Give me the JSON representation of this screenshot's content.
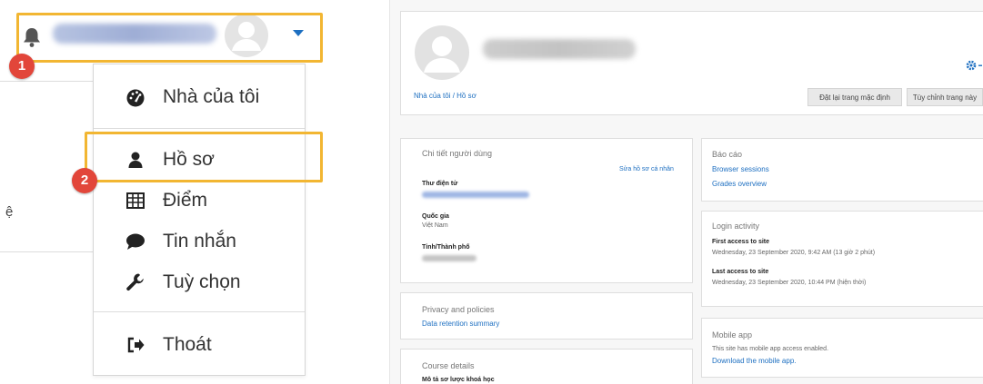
{
  "left": {
    "menu": [
      {
        "label": "Nhà của tôi",
        "icon": "dashboard-icon"
      },
      {
        "label": "Hồ sơ",
        "icon": "user-icon"
      },
      {
        "label": "Điểm",
        "icon": "table-grid-icon"
      },
      {
        "label": "Tin nhắn",
        "icon": "chat-bubble-icon"
      },
      {
        "label": "Tuỳ chọn",
        "icon": "wrench-icon"
      },
      {
        "label": "Thoát",
        "icon": "sign-out-icon"
      }
    ],
    "step1": "1",
    "step2": "2",
    "stray_text": "ệ",
    "highlight_color": "#f2b632",
    "step_color": "#e2463a"
  },
  "right": {
    "breadcrumb": "Nhà của tôi  /  Hồ sơ",
    "buttons": {
      "reset": "Đặt lại trang mặc định",
      "customize": "Tùy chỉnh trang này"
    },
    "user_details": {
      "title": "Chi tiết người dùng",
      "edit_link": "Sửa hồ sơ cá nhân",
      "email_label": "Thư điện tử",
      "country_label": "Quốc gia",
      "country_value": "Việt Nam",
      "city_label": "Tỉnh/Thành phố"
    },
    "privacy": {
      "title": "Privacy and policies",
      "link": "Data retention summary"
    },
    "course": {
      "title": "Course details",
      "label": "Mô tả sơ lược khoá học"
    },
    "reports": {
      "title": "Báo cáo",
      "link1": "Browser sessions",
      "link2": "Grades overview"
    },
    "login": {
      "title": "Login activity",
      "first_label": "First access to site",
      "first_value": "Wednesday, 23 September 2020, 9:42 AM  (13 giờ 2 phút)",
      "last_label": "Last access to site",
      "last_value": "Wednesday, 23 September 2020, 10:44 PM  (hiện thời)"
    },
    "mobile": {
      "title": "Mobile app",
      "text": "This site has mobile app access enabled.",
      "link": "Download the mobile app."
    }
  }
}
